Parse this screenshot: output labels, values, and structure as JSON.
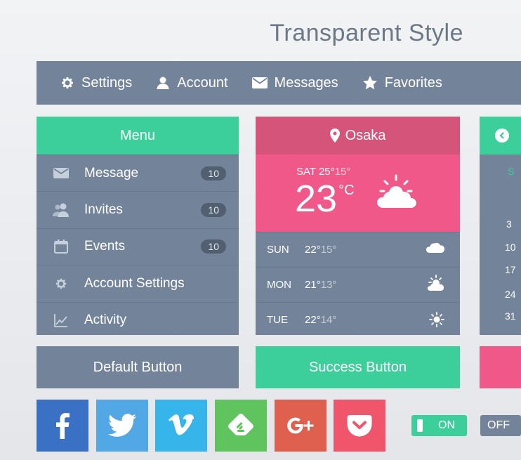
{
  "title": "Transparent Style",
  "topbar": {
    "items": [
      {
        "label": "Settings",
        "icon": "gear-icon"
      },
      {
        "label": "Account",
        "icon": "user-icon"
      },
      {
        "label": "Messages",
        "icon": "envelope-icon"
      },
      {
        "label": "Favorites",
        "icon": "star-icon"
      }
    ]
  },
  "menu": {
    "header": "Menu",
    "items": [
      {
        "label": "Message",
        "icon": "envelope-icon",
        "badge": "10"
      },
      {
        "label": "Invites",
        "icon": "users-icon",
        "badge": "10"
      },
      {
        "label": "Events",
        "icon": "calendar-icon",
        "badge": "10"
      },
      {
        "label": "Account Settings",
        "icon": "gear-icon",
        "badge": ""
      },
      {
        "label": "Activity",
        "icon": "chart-icon",
        "badge": ""
      }
    ]
  },
  "weather": {
    "city": "Osaka",
    "today": {
      "day": "SAT",
      "high": "25°",
      "low": "15°",
      "temp": "23",
      "unit": "°C",
      "icon": "partly-cloudy-icon"
    },
    "forecast": [
      {
        "day": "SUN",
        "high": "22°",
        "low": "15°",
        "icon": "cloud-icon"
      },
      {
        "day": "MON",
        "high": "21°",
        "low": "13°",
        "icon": "partly-cloudy-icon"
      },
      {
        "day": "TUE",
        "high": "22°",
        "low": "14°",
        "icon": "sun-icon"
      }
    ]
  },
  "calendar": {
    "weekday_header": "S",
    "dates": [
      "3",
      "10",
      "17",
      "24",
      "31"
    ]
  },
  "buttons": {
    "default_label": "Default Button",
    "success_label": "Success Button"
  },
  "social": [
    {
      "name": "facebook",
      "color": "#3b71c4"
    },
    {
      "name": "twitter",
      "color": "#52a7e5"
    },
    {
      "name": "vimeo",
      "color": "#35b5e9"
    },
    {
      "name": "feedly",
      "color": "#5fc45d"
    },
    {
      "name": "google-plus",
      "color": "#e0604f"
    },
    {
      "name": "pocket",
      "color": "#f0556b"
    }
  ],
  "toggles": {
    "on_label": "ON",
    "off_label": "OFF"
  },
  "colors": {
    "slate": "#73839a",
    "green": "#3cce9b",
    "pink": "#f0588a",
    "rose": "#d5547a"
  }
}
